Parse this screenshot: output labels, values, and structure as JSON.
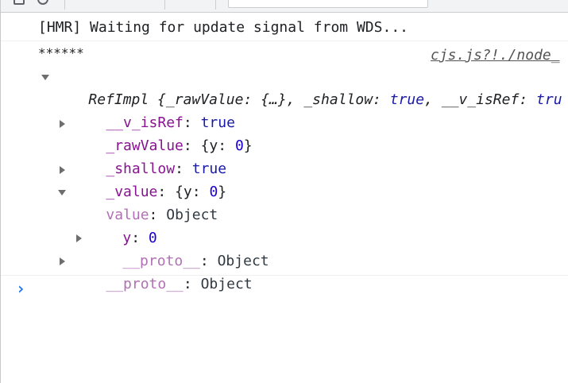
{
  "console": {
    "hmr_message": "[HMR] Waiting for update signal from WDS...",
    "stars_message": "******",
    "source_link": "cjs.js?!./node_",
    "refimpl_summary": {
      "class_name": "RefImpl",
      "open_brace": " {",
      "k1": "_rawValue",
      "colon1": ": ",
      "v1": "{…}",
      "comma1": ", ",
      "k2": "_shallow",
      "colon2": ": ",
      "v2": "true",
      "comma2": ", ",
      "k3": "__v_isRef",
      "colon3": ": ",
      "v3": "tru"
    },
    "props": {
      "v_isref_key": "__v_isRef",
      "v_isref_value": "true",
      "rawvalue_key": "_rawValue",
      "rawvalue_open": "{y: ",
      "rawvalue_num": "0",
      "rawvalue_close": "}",
      "shallow_key": "_shallow",
      "shallow_value": "true",
      "value_private_key": "_value",
      "value_private_open": "{y: ",
      "value_private_num": "0",
      "value_private_close": "}",
      "value_key": "value",
      "value_type": "Object",
      "y_key": "y",
      "y_value": "0",
      "proto_inner_key": "__proto__",
      "proto_inner_type": "Object",
      "proto_outer_key": "__proto__",
      "proto_outer_type": "Object"
    },
    "colon": ": ",
    "prompt_glyph": "›"
  }
}
